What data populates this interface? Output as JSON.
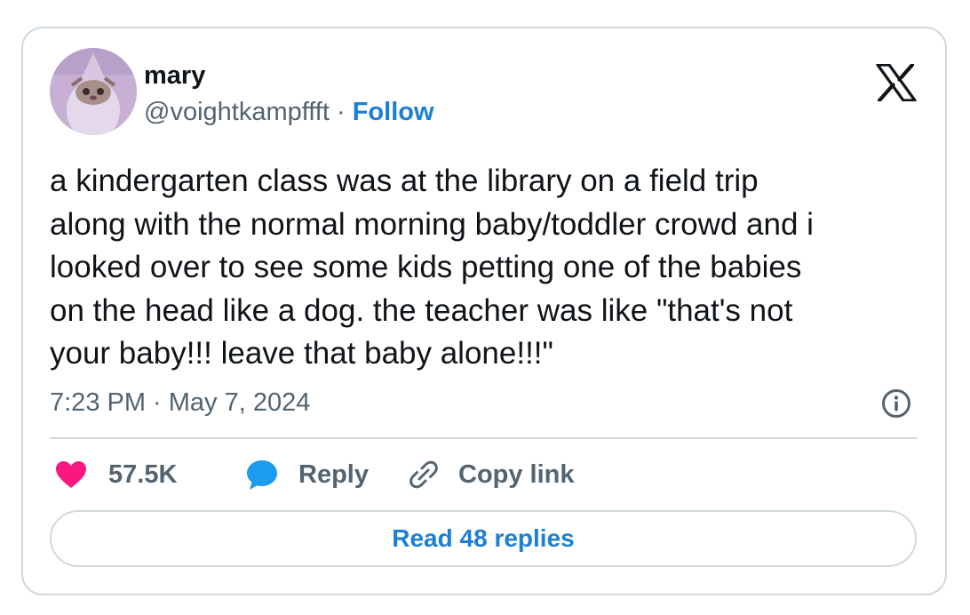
{
  "author": {
    "name": "mary",
    "handle": "@voightkampffft",
    "separator": "·",
    "follow_label": "Follow"
  },
  "tweet": {
    "text": "a kindergarten class was at the library on a field trip\nalong with the normal morning baby/toddler crowd and i\nlooked over to see some kids petting one of the babies\non the head like a dog. the teacher was like \"that's not\nyour baby!!! leave that baby alone!!!\"",
    "timestamp": "7:23 PM · May 7, 2024"
  },
  "actions": {
    "like_count": "57.5K",
    "reply_label": "Reply",
    "copy_link_label": "Copy link"
  },
  "read_replies_label": "Read 48 replies",
  "icons": {
    "brand": "x-logo-icon",
    "like": "heart-icon",
    "reply": "speech-bubble-icon",
    "copy": "link-icon",
    "info": "info-icon"
  },
  "colors": {
    "like": "#f91880",
    "reply": "#1d9bf0",
    "link_blue": "#1d7fd1",
    "secondary_text": "#536471",
    "border": "#cfd9de"
  }
}
